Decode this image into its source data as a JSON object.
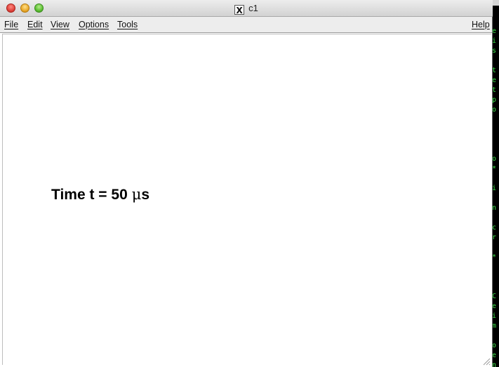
{
  "window": {
    "title": "c1",
    "app_icon_glyph": "X"
  },
  "menubar": {
    "file": "File",
    "edit": "Edit",
    "view": "View",
    "options": "Options",
    "tools": "Tools",
    "help": "Help"
  },
  "canvas": {
    "text_prefix": "Time t = 50",
    "text_unit_mu": "μ",
    "text_unit_s": "s"
  },
  "terminal": {
    "lines": [
      "e",
      "i",
      "s",
      "",
      "t",
      "e",
      "t",
      "p",
      "o",
      "",
      "",
      "",
      "",
      "o",
      "*",
      "",
      "i",
      "",
      "n",
      "",
      "c",
      "r",
      "",
      "*",
      "",
      "",
      "",
      "C",
      "e",
      "i",
      "m",
      "",
      "o",
      "e",
      "n"
    ]
  },
  "colors": {
    "terminal_text": "#3ee24a",
    "window_bg": "#ffffff",
    "menubar_bg": "#ededed"
  }
}
